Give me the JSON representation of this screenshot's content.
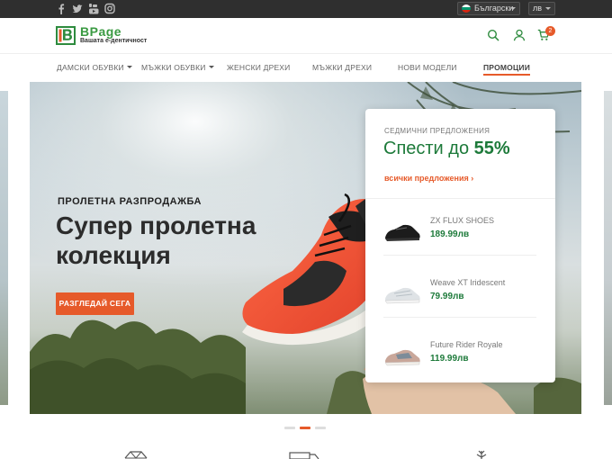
{
  "topbar": {
    "social_icons": [
      "facebook-icon",
      "twitter-icon",
      "youtube-icon",
      "instagram-icon"
    ],
    "language": "Български",
    "currency": "лв"
  },
  "header": {
    "logo_name": "BPage",
    "logo_tagline": "Вашата е-дентичност",
    "icons": [
      "search-icon",
      "user-icon",
      "cart-icon"
    ],
    "cart_count": "2"
  },
  "nav": {
    "items": [
      {
        "label": "ДАМСКИ ОБУВКИ",
        "dropdown": true
      },
      {
        "label": "МЪЖКИ ОБУВКИ",
        "dropdown": true
      },
      {
        "label": "ЖЕНСКИ ДРЕХИ",
        "dropdown": false
      },
      {
        "label": "МЪЖКИ ДРЕХИ",
        "dropdown": false
      },
      {
        "label": "НОВИ МОДЕЛИ",
        "dropdown": false
      },
      {
        "label": "ПРОМОЦИИ",
        "dropdown": false,
        "active": true
      }
    ]
  },
  "hero": {
    "kicker": "ПРОЛЕТНА РАЗПРОДАЖБА",
    "headline": "Супер пролетна колекция",
    "cta": "РАЗГЛЕДАЙ СЕГА"
  },
  "offers": {
    "label": "СЕДМИЧНИ ПРЕДЛОЖЕНИЯ",
    "save_text": "Спести до",
    "save_value": "55%",
    "all_link": "всички предложения",
    "products": [
      {
        "name": "ZX FLUX SHOES",
        "price": "189.99лв"
      },
      {
        "name": "Weave XT Iridescent",
        "price": "79.99лв"
      },
      {
        "name": "Future Rider Royale",
        "price": "119.99лв"
      }
    ]
  },
  "slider": {
    "active_index": 1,
    "count": 3
  },
  "colors": {
    "accent": "#e65a2a",
    "brand_green": "#1d7a3a",
    "topbar": "#2f2f2f"
  }
}
